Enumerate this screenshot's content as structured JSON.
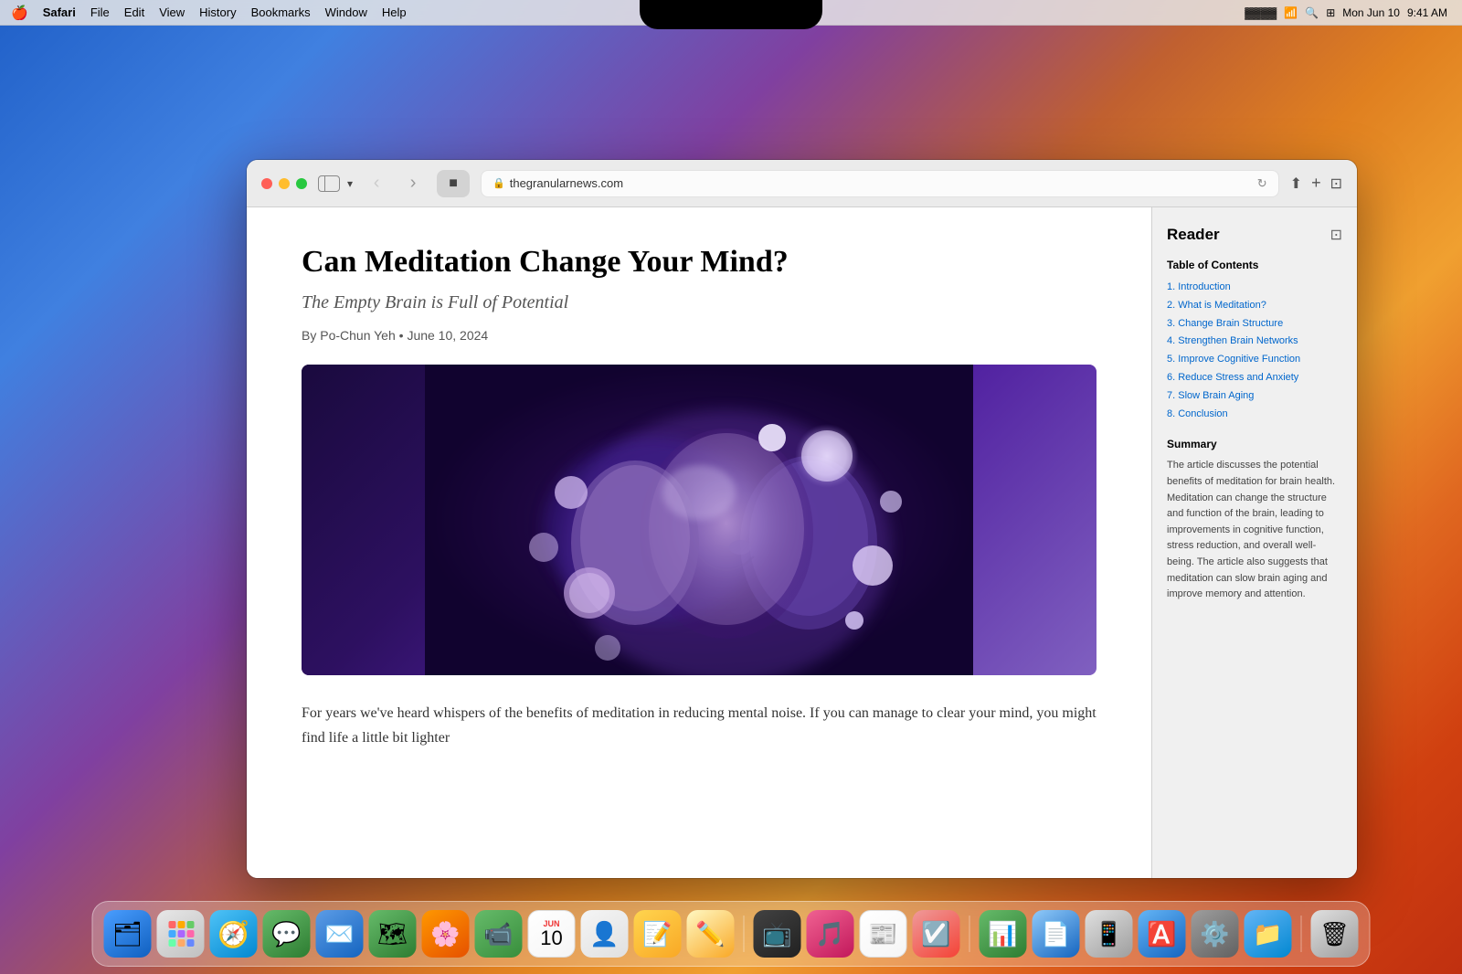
{
  "desktop": {
    "background": "macOS Sonoma wallpaper gradient"
  },
  "menubar": {
    "apple_symbol": "🍎",
    "app_name": "Safari",
    "menus": [
      "File",
      "Edit",
      "View",
      "History",
      "Bookmarks",
      "Window",
      "Help"
    ],
    "time": "9:41 AM",
    "date": "Mon Jun 10",
    "battery": "▓▓▓▓",
    "wifi": "wifi",
    "search": "⌕",
    "controlcenter": "⊞"
  },
  "safari": {
    "url": "thegranularnews.com",
    "tab_icon": "🟦",
    "toolbar_icons": {
      "back": "‹",
      "forward": "›",
      "share": "⬆",
      "new_tab": "+",
      "tabs": "⊡",
      "reload": "↻"
    }
  },
  "article": {
    "title": "Can Meditation Change Your Mind?",
    "subtitle": "The Empty Brain is Full of Potential",
    "byline": "By Po-Chun Yeh",
    "date": "June 10, 2024",
    "body_text": "For years we've heard whispers of the benefits of meditation in reducing mental noise. If you can manage to clear your mind, you might find life a little bit lighter"
  },
  "reader": {
    "panel_title": "Reader",
    "toc_title": "Table of Contents",
    "toc_items": [
      "1. Introduction",
      "2. What is Meditation?",
      "3. Change Brain Structure",
      "4. Strengthen Brain Networks",
      "5. Improve Cognitive Function",
      "6. Reduce Stress and Anxiety",
      "7. Slow Brain Aging",
      "8. Conclusion"
    ],
    "summary_title": "Summary",
    "summary_text": "The article discusses the potential benefits of meditation for brain health. Meditation can change the structure and function of the brain, leading to improvements in cognitive function, stress reduction, and overall well-being. The article also suggests that meditation can slow brain aging and improve memory and attention."
  },
  "dock": {
    "icons": [
      {
        "name": "Finder",
        "emoji": "🗂",
        "class": "dock-icon-finder"
      },
      {
        "name": "Launchpad",
        "emoji": "⊞",
        "class": "dock-icon-launchpad"
      },
      {
        "name": "Safari",
        "emoji": "🧭",
        "class": "dock-icon-safari"
      },
      {
        "name": "Messages",
        "emoji": "💬",
        "class": "dock-icon-messages"
      },
      {
        "name": "Mail",
        "emoji": "✉️",
        "class": "dock-icon-mail"
      },
      {
        "name": "Maps",
        "emoji": "🗺",
        "class": "dock-icon-maps"
      },
      {
        "name": "Photos",
        "emoji": "🌅",
        "class": "dock-icon-photos"
      },
      {
        "name": "FaceTime",
        "emoji": "📷",
        "class": "dock-icon-facetime"
      },
      {
        "name": "Calendar",
        "emoji": "10",
        "class": "dock-icon-calendar"
      },
      {
        "name": "Contacts",
        "emoji": "👤",
        "class": "dock-icon-contacts"
      },
      {
        "name": "Notes",
        "emoji": "📝",
        "class": "dock-icon-notes"
      },
      {
        "name": "Freeform",
        "emoji": "✏️",
        "class": "dock-icon-freeform"
      },
      {
        "name": "Apple TV",
        "emoji": "📺",
        "class": "dock-icon-appletv"
      },
      {
        "name": "Music",
        "emoji": "🎵",
        "class": "dock-icon-music"
      },
      {
        "name": "News",
        "emoji": "📰",
        "class": "dock-icon-news"
      },
      {
        "name": "Reminders",
        "emoji": "☑️",
        "class": "dock-icon-reminders"
      },
      {
        "name": "Numbers",
        "emoji": "📊",
        "class": "dock-icon-numbers"
      },
      {
        "name": "Pages",
        "emoji": "📄",
        "class": "dock-icon-pages"
      },
      {
        "name": "iPhone Mirroring",
        "emoji": "📱",
        "class": "dock-icon-iphone"
      },
      {
        "name": "App Store",
        "emoji": "🅰",
        "class": "dock-icon-appstore"
      },
      {
        "name": "System Settings",
        "emoji": "⚙️",
        "class": "dock-icon-settings"
      },
      {
        "name": "Files",
        "emoji": "📁",
        "class": "dock-icon-files"
      },
      {
        "name": "Trash",
        "emoji": "🗑",
        "class": "dock-icon-trash"
      }
    ]
  }
}
